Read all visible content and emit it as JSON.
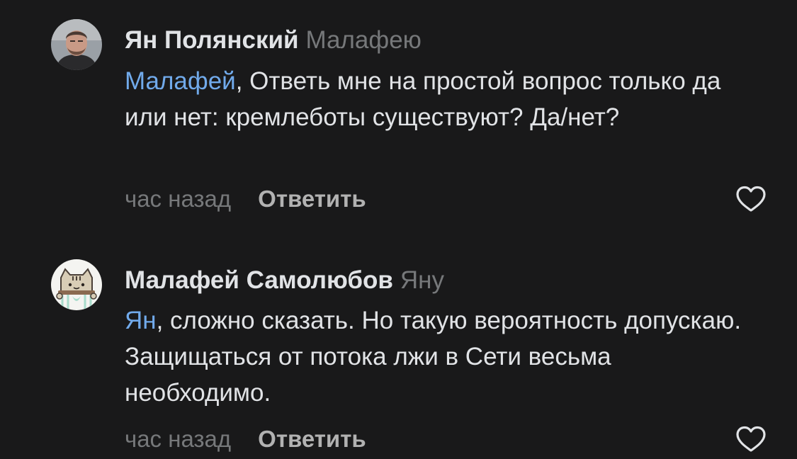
{
  "comments": [
    {
      "author": "Ян Полянский",
      "reply_to": "Малафею",
      "mention": "Малафей",
      "text": ", Ответь мне на простой вопрос только да или нет: кремлеботы существуют? Да/нет?",
      "time": "час назад",
      "reply_label": "Ответить",
      "avatar_icon": "user-photo-avatar",
      "like_icon": "heart-outline-icon"
    },
    {
      "author": "Малафей Самолюбов",
      "reply_to": "Яну",
      "mention": "Ян",
      "text": ", сложно сказать. Но такую вероятность допускаю. Защищаться от потока лжи в Сети весьма необходимо.",
      "time": "час назад",
      "reply_label": "Ответить",
      "avatar_icon": "cat-sticker-avatar",
      "like_icon": "heart-outline-icon"
    }
  ],
  "colors": {
    "background": "#19191a",
    "text": "#e1e3e6",
    "secondary": "#76787a",
    "mention": "#71aaeb",
    "reply_button": "#b2b2b2"
  }
}
